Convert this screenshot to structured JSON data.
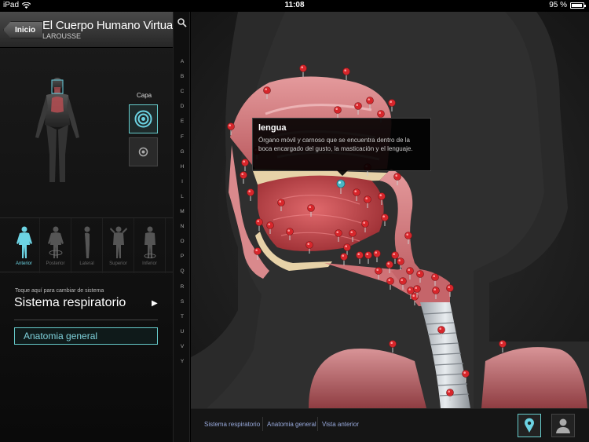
{
  "status": {
    "carrier": "iPad",
    "time": "11:08",
    "battery": "95 %",
    "battery_level": 0.95
  },
  "header": {
    "back_label": "Inicio",
    "title": "El Cuerpo Humano Virtual",
    "subtitle": "LAROUSSE"
  },
  "layer": {
    "label": "Capa"
  },
  "views": [
    {
      "label": "Anterior",
      "active": true
    },
    {
      "label": "Posterior",
      "active": false
    },
    {
      "label": "Lateral",
      "active": false
    },
    {
      "label": "Superior",
      "active": false
    },
    {
      "label": "Inferior",
      "active": false
    }
  ],
  "system": {
    "hint": "Toque aquí para cambiar de sistema",
    "name": "Sistema respiratorio",
    "arrow": "▶"
  },
  "section_button": "Anatomia general",
  "alphabet": [
    "A",
    "B",
    "C",
    "D",
    "E",
    "F",
    "G",
    "H",
    "I",
    "L",
    "M",
    "N",
    "O",
    "P",
    "Q",
    "R",
    "S",
    "T",
    "U",
    "V",
    "Y"
  ],
  "tooltip": {
    "title": "lengua",
    "description": "Órgano móvil y carnoso que se encuentra dentro de la boca encargado del gusto, la masticación y el lenguaje."
  },
  "footer": {
    "crumbs": [
      "Sistema respiratorio",
      "Anatomia general",
      "Vista anterior"
    ]
  },
  "colors": {
    "accent": "#6cd3e3",
    "pin": "#d7262b",
    "selected_pin": "#4ab6c4",
    "tissue": "#c9646a"
  }
}
